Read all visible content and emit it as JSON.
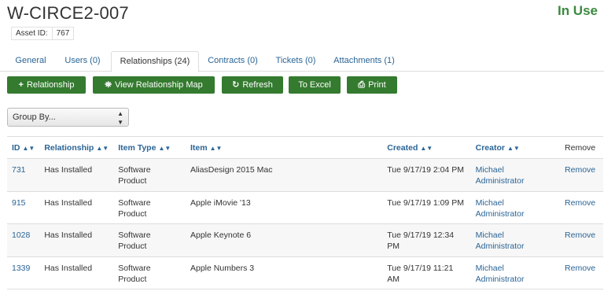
{
  "asset": {
    "title": "W-CIRCE2-007",
    "status": "In Use",
    "id_label": "Asset ID:",
    "id_value": "767"
  },
  "tabs": [
    {
      "label": "General",
      "active": false
    },
    {
      "label": "Users (0)",
      "active": false
    },
    {
      "label": "Relationships (24)",
      "active": true
    },
    {
      "label": "Contracts (0)",
      "active": false
    },
    {
      "label": "Tickets (0)",
      "active": false
    },
    {
      "label": "Attachments (1)",
      "active": false
    }
  ],
  "toolbar": {
    "relationship": "Relationship",
    "view_map": "View Relationship Map",
    "refresh": "Refresh",
    "to_excel": "To Excel",
    "print": "Print"
  },
  "groupby": {
    "selected": "Group By..."
  },
  "table": {
    "headers": {
      "id": "ID",
      "relationship": "Relationship",
      "item_type": "Item Type",
      "item": "Item",
      "created": "Created",
      "creator": "Creator",
      "remove": "Remove"
    },
    "rows": [
      {
        "id": "731",
        "relationship": "Has Installed",
        "item_type_1": "Software",
        "item_type_2": "Product",
        "item": "AliasDesign 2015 Mac",
        "created_1": "Tue 9/17/19 2:04 PM",
        "created_2": "",
        "creator_1": "Michael",
        "creator_2": "Administrator",
        "remove": "Remove"
      },
      {
        "id": "915",
        "relationship": "Has Installed",
        "item_type_1": "Software",
        "item_type_2": "Product",
        "item": "Apple iMovie '13",
        "created_1": "Tue 9/17/19 1:09 PM",
        "created_2": "",
        "creator_1": "Michael",
        "creator_2": "Administrator",
        "remove": "Remove"
      },
      {
        "id": "1028",
        "relationship": "Has Installed",
        "item_type_1": "Software",
        "item_type_2": "Product",
        "item": "Apple Keynote 6",
        "created_1": "Tue 9/17/19 12:34",
        "created_2": "PM",
        "creator_1": "Michael",
        "creator_2": "Administrator",
        "remove": "Remove"
      },
      {
        "id": "1339",
        "relationship": "Has Installed",
        "item_type_1": "Software",
        "item_type_2": "Product",
        "item": "Apple Numbers 3",
        "created_1": "Tue 9/17/19 11:21",
        "created_2": "AM",
        "creator_1": "Michael",
        "creator_2": "Administrator",
        "remove": "Remove"
      }
    ]
  },
  "colors": {
    "primary_button": "#347a2f",
    "link": "#2a6496",
    "status": "#3b8a3e"
  }
}
